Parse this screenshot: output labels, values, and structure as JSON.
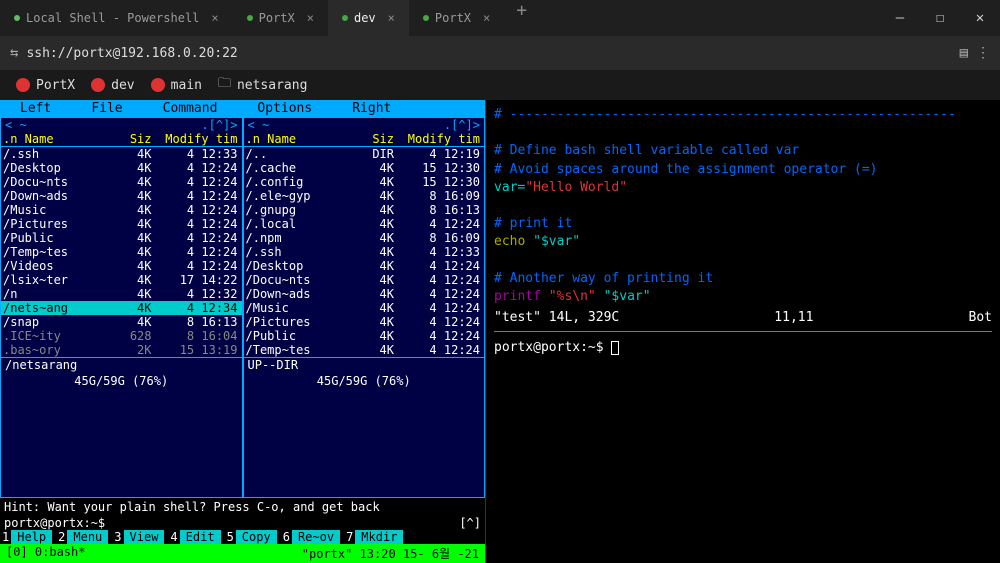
{
  "tabs": [
    {
      "label": "Local Shell - Powershell",
      "active": false
    },
    {
      "label": "PortX",
      "active": false
    },
    {
      "label": "dev",
      "active": true
    },
    {
      "label": "PortX",
      "active": false
    }
  ],
  "address": "ssh://portx@192.168.0.20:22",
  "subtabs": [
    {
      "label": "PortX",
      "icon": "red"
    },
    {
      "label": "dev",
      "icon": "red"
    },
    {
      "label": "main",
      "icon": "red"
    },
    {
      "label": "netsarang",
      "icon": "folder"
    }
  ],
  "mc": {
    "menu": [
      "Left",
      "File",
      "Command",
      "Options",
      "Right"
    ],
    "panelL": {
      "hdr_l": "< ~",
      "hdr_r": ".[^]>",
      "cols": {
        "n": ".n Name",
        "s": "Siz",
        "m": "Modify tim"
      },
      "rows": [
        {
          "n": "/.ssh",
          "s": "4K",
          "m": "4 12:33"
        },
        {
          "n": "/Desktop",
          "s": "4K",
          "m": "4 12:24"
        },
        {
          "n": "/Docu~nts",
          "s": "4K",
          "m": "4 12:24"
        },
        {
          "n": "/Down~ads",
          "s": "4K",
          "m": "4 12:24"
        },
        {
          "n": "/Music",
          "s": "4K",
          "m": "4 12:24"
        },
        {
          "n": "/Pictures",
          "s": "4K",
          "m": "4 12:24"
        },
        {
          "n": "/Public",
          "s": "4K",
          "m": "4 12:24"
        },
        {
          "n": "/Temp~tes",
          "s": "4K",
          "m": "4 12:24"
        },
        {
          "n": "/Videos",
          "s": "4K",
          "m": "4 12:24"
        },
        {
          "n": "/lsix~ter",
          "s": "4K",
          "m": "17 14:22"
        },
        {
          "n": "/n",
          "s": "4K",
          "m": "4 12:32"
        },
        {
          "n": "/nets~ang",
          "s": "4K",
          "m": "4 12:34",
          "sel": true
        },
        {
          "n": "/snap",
          "s": "4K",
          "m": "8 16:13"
        },
        {
          "n": " .ICE~ity",
          "s": "628",
          "m": "8 16:04",
          "dim": true
        },
        {
          "n": " .bas~ory",
          "s": "2K",
          "m": "15 13:19",
          "dim": true
        }
      ],
      "ftr": "/netsarang",
      "stat": "45G/59G (76%)"
    },
    "panelR": {
      "hdr_l": "< ~",
      "hdr_r": ".[^]>",
      "cols": {
        "n": ".n Name",
        "s": "Siz",
        "m": "Modify tim"
      },
      "rows": [
        {
          "n": "/..",
          "s": "DIR",
          "m": "4 12:19"
        },
        {
          "n": "/.cache",
          "s": "4K",
          "m": "15 12:30"
        },
        {
          "n": "/.config",
          "s": "4K",
          "m": "15 12:30"
        },
        {
          "n": "/.ele~gyp",
          "s": "4K",
          "m": "8 16:09"
        },
        {
          "n": "/.gnupg",
          "s": "4K",
          "m": "8 16:13"
        },
        {
          "n": "/.local",
          "s": "4K",
          "m": "4 12:24"
        },
        {
          "n": "/.npm",
          "s": "4K",
          "m": "8 16:09"
        },
        {
          "n": "/.ssh",
          "s": "4K",
          "m": "4 12:33"
        },
        {
          "n": "/Desktop",
          "s": "4K",
          "m": "4 12:24"
        },
        {
          "n": "/Docu~nts",
          "s": "4K",
          "m": "4 12:24"
        },
        {
          "n": "/Down~ads",
          "s": "4K",
          "m": "4 12:24"
        },
        {
          "n": "/Music",
          "s": "4K",
          "m": "4 12:24"
        },
        {
          "n": "/Pictures",
          "s": "4K",
          "m": "4 12:24"
        },
        {
          "n": "/Public",
          "s": "4K",
          "m": "4 12:24"
        },
        {
          "n": "/Temp~tes",
          "s": "4K",
          "m": "4 12:24"
        }
      ],
      "ftr": "UP--DIR",
      "stat": "45G/59G (76%)"
    },
    "hint": "Hint: Want your plain shell? Press C-o, and get back",
    "prompt": "portx@portx:~$",
    "prompt_r": "[^]",
    "fn": [
      {
        "n": "1",
        "l": "Help"
      },
      {
        "n": "2",
        "l": "Menu"
      },
      {
        "n": "3",
        "l": "View"
      },
      {
        "n": "4",
        "l": "Edit"
      },
      {
        "n": "5",
        "l": "Copy"
      },
      {
        "n": "6",
        "l": "Re~ov"
      },
      {
        "n": "7",
        "l": "Mkdir"
      }
    ]
  },
  "code": {
    "l1": "# ---------------------------------------------------------",
    "l2": "# Define bash shell variable called var",
    "l3": "# Avoid spaces around the assignment operator (=)",
    "l4a": "var=",
    "l4b": "\"Hello World\"",
    "l5": "# print it",
    "l6a": "echo ",
    "l6b": "\"$var\"",
    "l7": "# Another way of printing it",
    "l8a": "printf ",
    "l8b": "\"%s\\n\" ",
    "l8c": "\"$var\"",
    "vimstat_l": "\"test\" 14L, 329C",
    "vimstat_m": "11,11",
    "vimstat_r": "Bot",
    "rprompt": "portx@portx:~$ "
  },
  "status": {
    "l": "[0] 0:bash*",
    "r": "\"portx\" 13:20 15- 6월 -21"
  }
}
